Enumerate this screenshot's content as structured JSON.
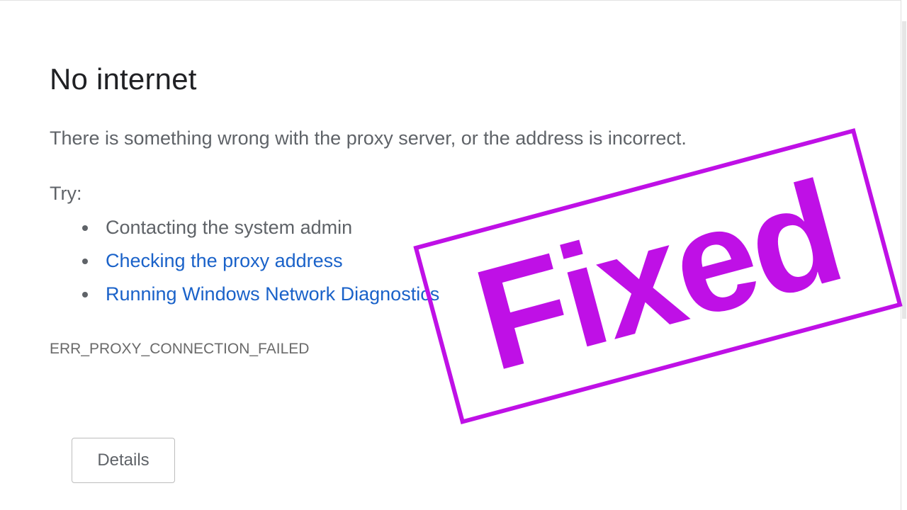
{
  "error_page": {
    "title": "No internet",
    "message": "There is something wrong with the proxy server, or the address is incorrect.",
    "try_label": "Try:",
    "suggestions": [
      {
        "label": "Contacting the system admin",
        "is_link": false
      },
      {
        "label": "Checking the proxy address",
        "is_link": true
      },
      {
        "label": "Running Windows Network Diagnostics",
        "is_link": true
      }
    ],
    "error_code": "ERR_PROXY_CONNECTION_FAILED",
    "details_button_label": "Details"
  },
  "overlay": {
    "stamp_text": "Fixed",
    "stamp_color": "#bf10e6"
  },
  "colors": {
    "title": "#202124",
    "body_text": "#5f6368",
    "link": "#1a62c9"
  }
}
